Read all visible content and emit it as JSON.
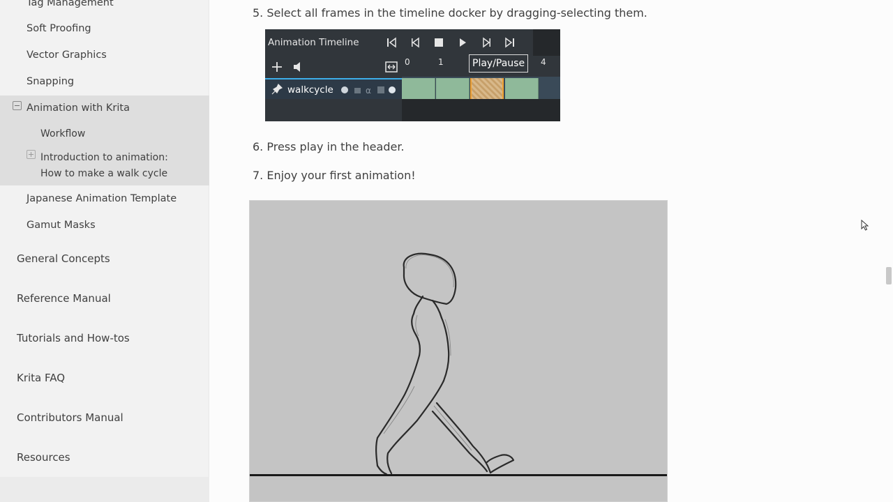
{
  "sidebar": {
    "sub_items_top": [
      {
        "label": "Tag Management"
      },
      {
        "label": "Soft Proofing"
      },
      {
        "label": "Vector Graphics"
      },
      {
        "label": "Snapping"
      }
    ],
    "active_section": {
      "label": "Animation with Krita",
      "children": [
        {
          "label": "Workflow"
        },
        {
          "label_line1": "Introduction to animation:",
          "label_line2": "How to make a walk cycle"
        }
      ]
    },
    "sub_items_after": [
      {
        "label": "Japanese Animation Template"
      },
      {
        "label": "Gamut Masks"
      }
    ],
    "top_level": [
      {
        "label": "General Concepts"
      },
      {
        "label": "Reference Manual"
      },
      {
        "label": "Tutorials and How-tos"
      },
      {
        "label": "Krita FAQ"
      },
      {
        "label": "Contributors Manual"
      },
      {
        "label": "Resources"
      }
    ]
  },
  "main": {
    "steps": [
      {
        "text": "5. Select all frames in the timeline docker by dragging-selecting them."
      },
      {
        "text": "6. Press play in the header."
      },
      {
        "text": "7. Enjoy your first animation!"
      }
    ],
    "timeline_image": {
      "title": "Animation Timeline",
      "layer_name": "walkcycle",
      "tooltip": "Play/Pause",
      "ticks": [
        "0",
        "1",
        "4"
      ],
      "frame_color": "#8fb99a",
      "accent": "#3daee9"
    }
  },
  "colors": {
    "sidebar_bg": "#f2f2f2",
    "sidebar_active_bg": "#dedede",
    "text": "#404040"
  }
}
